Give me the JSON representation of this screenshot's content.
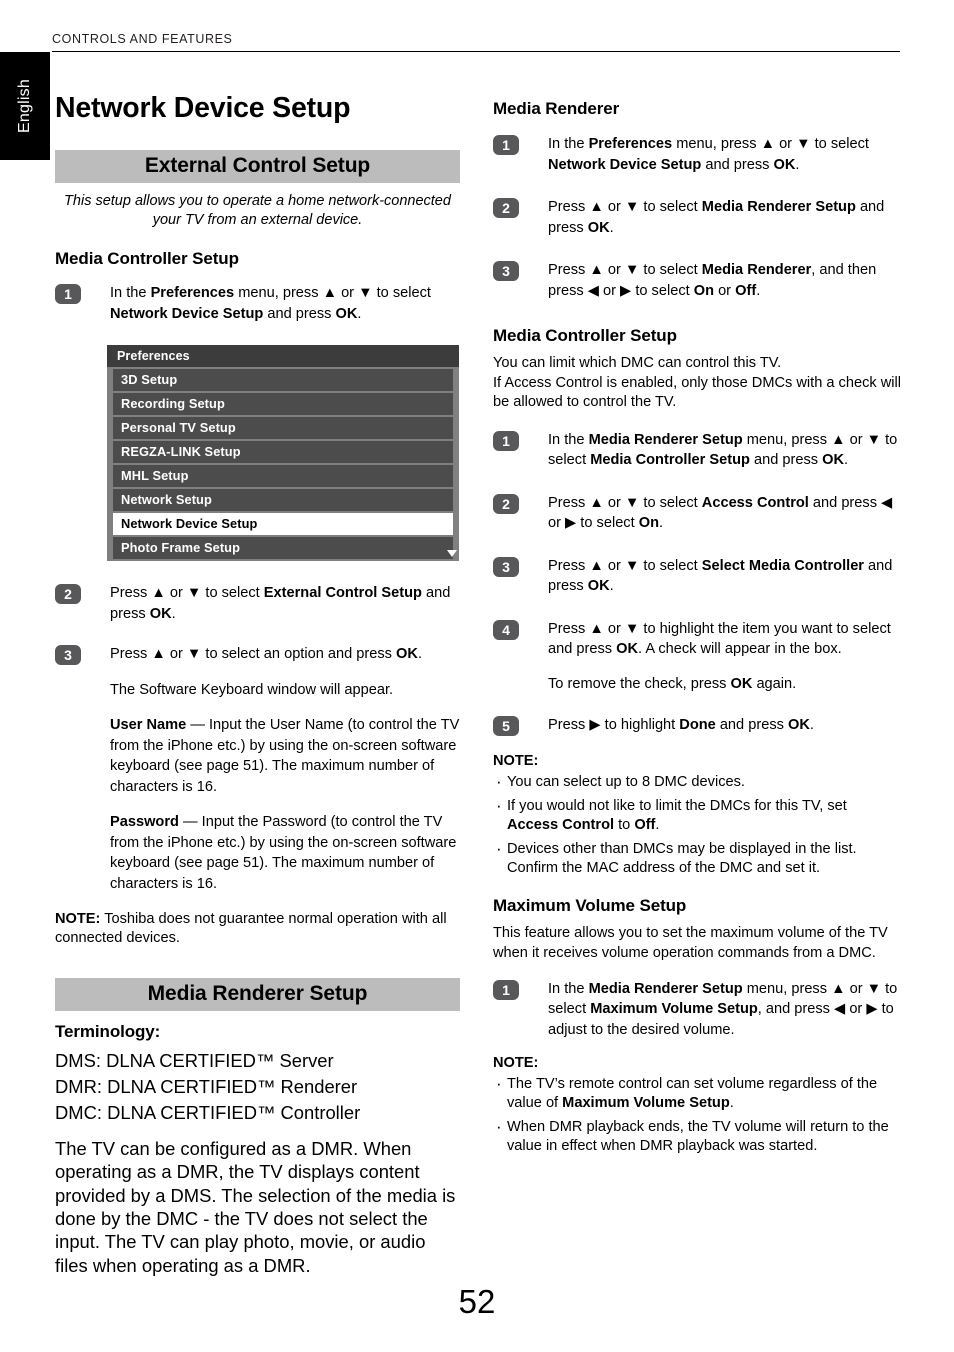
{
  "header": {
    "running_head": "CONTROLS AND FEATURES",
    "language_tab": "English"
  },
  "page_title": "Network Device Setup",
  "page_number": "52",
  "glyphs": {
    "up": "▲",
    "down": "▼",
    "left": "◀",
    "right": "▶",
    "scroll_down_icon": "▼"
  },
  "left_column": {
    "section_external": {
      "band_title": "External Control Setup",
      "intro": "This setup allows you to operate a home network-connected your TV from an external device.",
      "subheading": "Media Controller Setup",
      "steps": [
        {
          "num": "1",
          "html": "In the <b>Preferences</b> menu, press ▲ or ▼ to select <b>Network Device Setup</b> and press <b>OK</b>."
        },
        {
          "num": "2",
          "html": "Press ▲ or ▼ to select <b>External Control Setup</b> and press <b>OK</b>."
        },
        {
          "num": "3",
          "html": "Press ▲ or ▼ to select an option and press <b>OK</b>."
        }
      ],
      "after_step3": "The Software Keyboard window will appear.",
      "user_name_html": "<b>User Name</b> — Input the User Name (to control the TV from the iPhone etc.) by using the on-screen software keyboard (see page 51).  The maximum number of characters is 16.",
      "password_html": "<b>Password</b> — Input the Password (to control the TV from the  iPhone etc.) by using the on-screen software keyboard (see page 51).  The maximum number of characters is 16.",
      "note_html": "<b>NOTE:</b> Toshiba does not guarantee normal operation with all connected devices."
    },
    "osd_menu": {
      "title": "Preferences",
      "items": [
        {
          "label": "3D Setup",
          "selected": false
        },
        {
          "label": "Recording Setup",
          "selected": false
        },
        {
          "label": "Personal TV Setup",
          "selected": false
        },
        {
          "label": "REGZA-LINK Setup",
          "selected": false
        },
        {
          "label": "MHL Setup",
          "selected": false
        },
        {
          "label": "Network Setup",
          "selected": false
        },
        {
          "label": "Network Device Setup",
          "selected": true
        },
        {
          "label": "Photo Frame Setup",
          "selected": false
        }
      ]
    },
    "section_renderer": {
      "band_title": "Media Renderer Setup",
      "terminology_label": "Terminology:",
      "terms": [
        "DMS: DLNA CERTIFIED™ Server",
        "DMR: DLNA CERTIFIED™ Renderer",
        "DMC: DLNA CERTIFIED™ Controller"
      ],
      "description": "The TV can be configured as a DMR. When operating as a DMR, the TV displays content provided by a DMS. The selection of the media is done by the DMC - the TV does not select the input. The TV can play photo, movie, or audio files when operating as a DMR."
    }
  },
  "right_column": {
    "section_media_renderer": {
      "subheading": "Media Renderer",
      "steps": [
        {
          "num": "1",
          "html": "In the <b>Preferences</b> menu, press ▲ or ▼ to select <b>Network Device Setup</b> and press <b>OK</b>."
        },
        {
          "num": "2",
          "html": "Press ▲ or ▼ to select <b>Media Renderer Setup</b> and press <b>OK</b>."
        },
        {
          "num": "3",
          "html": "Press ▲ or ▼ to select <b>Media Renderer</b>, and then press ◀ or ▶ to select <b>On</b> or <b>Off</b>."
        }
      ]
    },
    "section_media_controller": {
      "subheading": "Media Controller Setup",
      "intro": "You can limit which DMC can control this TV.\nIf Access Control is enabled, only those DMCs with a check will be allowed to control the TV.",
      "steps": [
        {
          "num": "1",
          "html": "In the <b>Media Renderer Setup</b> menu, press ▲ or ▼ to select <b>Media Controller Setup</b> and press <b>OK</b>."
        },
        {
          "num": "2",
          "html": "Press ▲ or ▼ to select <b>Access Control</b> and press ◀ or ▶ to select <b>On</b>."
        },
        {
          "num": "3",
          "html": "Press ▲ or ▼ to select <b>Select Media Controller</b> and press <b>OK</b>."
        },
        {
          "num": "4",
          "html": "Press ▲ or ▼ to highlight the item you want to select and press <b>OK</b>. A check will appear in the box."
        },
        {
          "num": "5",
          "html": "Press ▶ to highlight <b>Done</b> and press <b>OK</b>."
        }
      ],
      "step4_extra_html": "To remove the check, press <b>OK</b> again.",
      "note_label": "NOTE:",
      "notes": [
        "You can select up to 8 DMC devices.",
        "If you would not like to limit the DMCs for this TV, set <b>Access Control</b> to <b>Off</b>.",
        "Devices other than DMCs may be displayed in the list. Confirm the MAC address of the DMC and set it."
      ]
    },
    "section_max_volume": {
      "subheading": "Maximum Volume Setup",
      "intro": "This feature allows you to set the maximum volume of the TV when it receives volume operation commands from a DMC.",
      "steps": [
        {
          "num": "1",
          "html": "In the <b>Media Renderer Setup</b> menu, press ▲ or ▼ to select <b>Maximum Volume Setup</b>, and press ◀ or ▶ to adjust to the desired volume."
        }
      ],
      "note_label": "NOTE:",
      "notes": [
        "The TV’s remote control can set volume regardless of the value of <b>Maximum Volume Setup</b>.",
        "When DMR playback ends, the TV volume will return to the value in effect when DMR playback was started."
      ]
    }
  },
  "colors": {
    "band_gray": "#bcbcbc",
    "badge_gray": "#58585a",
    "osd_title_bg": "#3c3c3c",
    "osd_row_bg": "#4c4c4c",
    "osd_panel_bg": "#808080",
    "osd_selected_bg": "#ffffff"
  }
}
